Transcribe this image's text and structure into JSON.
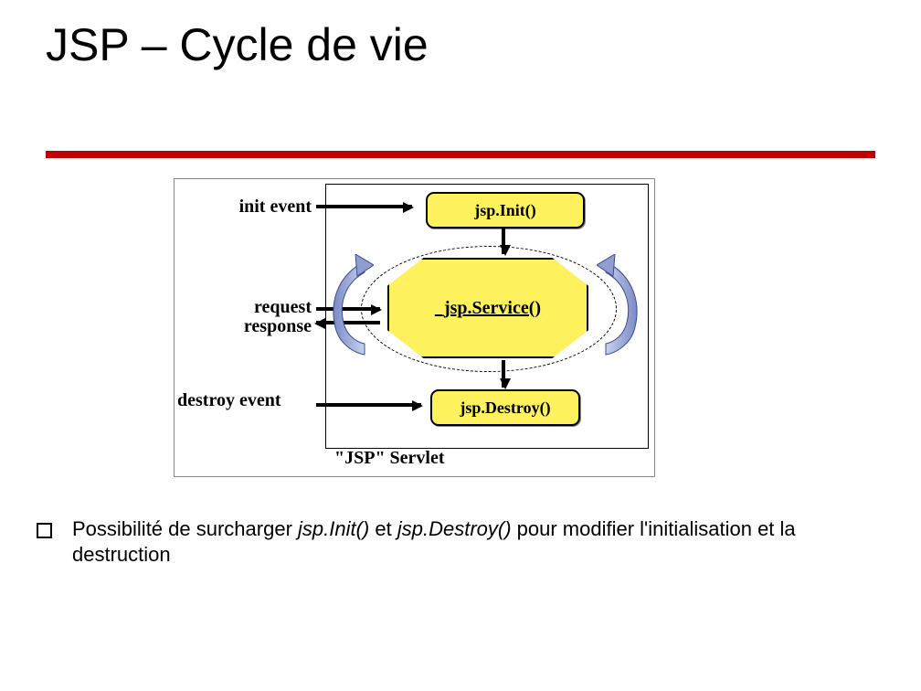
{
  "title": "JSP – Cycle de vie",
  "diagram": {
    "labels": {
      "init_event": "init event",
      "request": "request",
      "response": "response",
      "destroy_event": "destroy event",
      "jsp_servlet_caption": "\"JSP\" Servlet"
    },
    "boxes": {
      "init": "jsp.Init()",
      "service": "_jsp.Service()",
      "destroy": "jsp.Destroy()"
    }
  },
  "bullet": {
    "part1": "Possibilité de surcharger ",
    "italic1": "jsp.Init()",
    "part2": " et ",
    "italic2": "jsp.Destroy()",
    "part3": " pour modifier l'initialisation et la destruction"
  },
  "colors": {
    "title_rule": "#c00000",
    "box_fill": "#fdf25e",
    "loop_arrow": "#9aa9d4"
  }
}
